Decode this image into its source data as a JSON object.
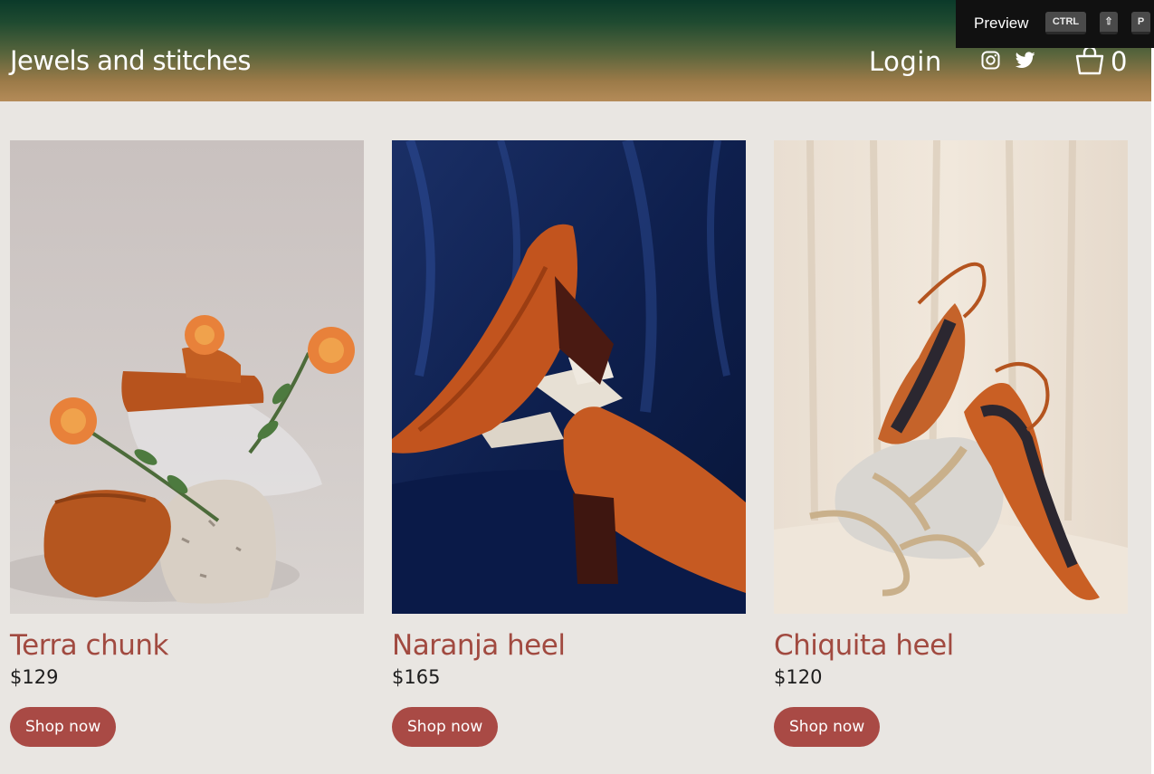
{
  "header": {
    "brand": "Jewels and stitches",
    "login": "Login",
    "cart_count": "0",
    "social_icons": [
      "instagram-icon",
      "twitter-icon"
    ],
    "cart_icon": "shopping-bag-icon"
  },
  "preview": {
    "label": "Preview",
    "keys": [
      "CTRL",
      "⇧",
      "P"
    ]
  },
  "products": [
    {
      "name": "Terra chunk",
      "price": "$129",
      "button": "Shop now"
    },
    {
      "name": "Naranja heel",
      "price": "$165",
      "button": "Shop now"
    },
    {
      "name": "Chiquita heel",
      "price": "$120",
      "button": "Shop now"
    }
  ],
  "colors": {
    "background": "#e9e6e2",
    "product_name": "#a14a40",
    "button": "#a94a45",
    "header_top": "#0b3a2a",
    "header_bottom": "#b48b58"
  }
}
